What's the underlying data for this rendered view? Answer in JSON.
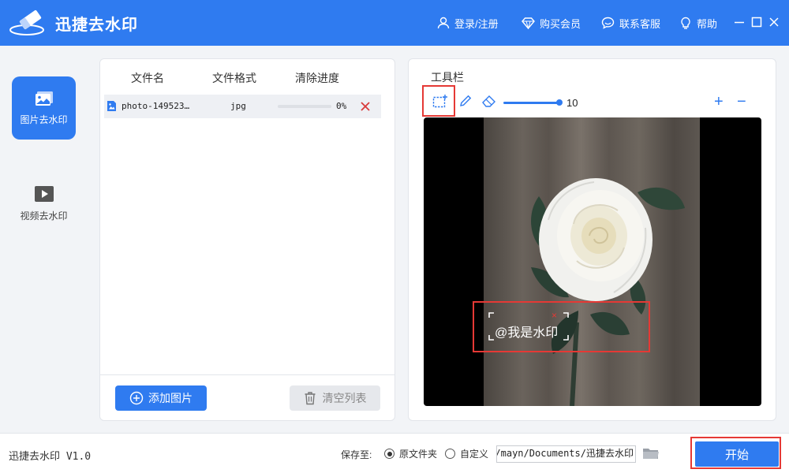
{
  "app": {
    "title": "迅捷去水印",
    "version": "迅捷去水印 V1.0"
  },
  "titlebar": {
    "login": "登录/注册",
    "buy_vip": "购买会员",
    "support": "联系客服",
    "help": "帮助"
  },
  "sidebar": {
    "items": [
      {
        "label": "图片去水印",
        "icon": "image-icon",
        "active": true
      },
      {
        "label": "视频去水印",
        "icon": "video-play-icon",
        "active": false
      }
    ]
  },
  "file_list": {
    "columns": [
      "文件名",
      "文件格式",
      "清除进度"
    ],
    "rows": [
      {
        "name": "photo-149523…",
        "format": "jpg",
        "progress_text": "0%",
        "progress": 0
      }
    ],
    "add_button": "添加图片",
    "clear_button": "清空列表"
  },
  "toolbar": {
    "title": "工具栏",
    "brush_size": "10",
    "brush_size_value": 10,
    "zoom_in": "+",
    "zoom_out": "−"
  },
  "preview": {
    "watermark_text": "@我是水印",
    "watermark_close": "×"
  },
  "bottom": {
    "save_to_label": "保存至:",
    "option_source": "原文件夹",
    "option_custom": "自定义",
    "selected_option": "原文件夹",
    "path_value": "C:/Users/mayn/Documents/迅捷去水印",
    "start_button": "开始"
  },
  "colors": {
    "primary": "#2f7bf0",
    "highlight": "#e53935",
    "delete": "#e53935"
  }
}
